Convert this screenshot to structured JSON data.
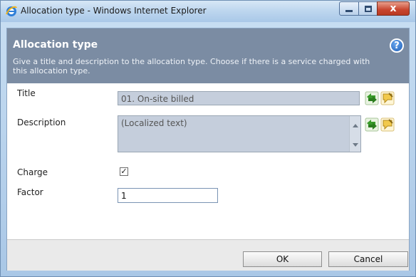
{
  "window": {
    "title": "Allocation type - Windows Internet Explorer",
    "close_label": "x"
  },
  "header": {
    "title": "Allocation type",
    "description": "Give a title and description to the allocation type. Choose if there is a service charged with this allocation type.",
    "help_glyph": "?"
  },
  "form": {
    "title_label": "Title",
    "title_value": "01. On-site billed",
    "description_label": "Description",
    "description_value": "(Localized text)",
    "charge_label": "Charge",
    "charge_checked": true,
    "charge_mark": "✓",
    "factor_label": "Factor",
    "factor_value": "1"
  },
  "footer": {
    "ok_label": "OK",
    "cancel_label": "Cancel"
  },
  "icons": {
    "browser": "ie-icon",
    "help": "help-icon",
    "translate": "translate-icon",
    "comment": "comment-icon"
  },
  "colors": {
    "header_bg": "#7b8ca3",
    "readonly_field_bg": "#c5cedc",
    "close_button": "#c8452e"
  }
}
